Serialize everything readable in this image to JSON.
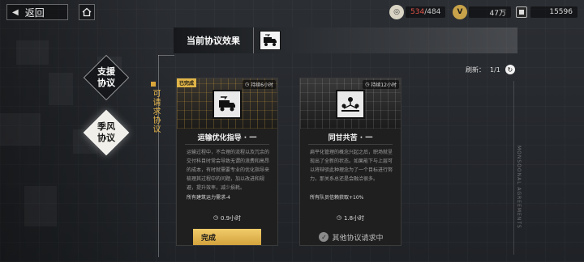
{
  "top_bar": {
    "back_label": "返回",
    "resources": [
      {
        "icon": "gold-coin-icon",
        "current": "534",
        "max": "/484"
      },
      {
        "icon": "v-coin-icon",
        "value": "47万"
      },
      {
        "icon": "chip-icon",
        "value": "15596"
      }
    ]
  },
  "nav": {
    "items": [
      {
        "label": "支援\n协议"
      },
      {
        "label": "季风\n协议"
      }
    ]
  },
  "header": {
    "title": "当前协议效果"
  },
  "panel": {
    "side_label": "可请求协议",
    "refresh_label": "刷新：",
    "refresh_count": "1/1",
    "vertical_text": "MONSOONAL AGREEMENTS"
  },
  "cards": [
    {
      "badge": "已完成",
      "duration": "持续6小时",
      "title": "运输优化指导 · 一",
      "description": "运输过程中，不合理的流程以及冗余的交付科目时常会导致无谓的浪费和高昂的成本，有时就需要专业的优化指导来梳理其过程中的问题，加以改进和规避，提升效率，减少损耗。",
      "effect": "所有建筑运力需求-4",
      "time": "0.9小时",
      "action_label": "完成"
    },
    {
      "duration": "持续12小时",
      "title": "同甘共苦 · 一",
      "description": "扁平化管理的概念兴起之后，职场就呈现出了全新的状态。如果能下与上层可以将辩驳此种理念为了一个目标进行努力，那关系总还是会融洽很多。",
      "effect": "所有队员信赖获取+10%",
      "time": "1.8小时",
      "status_label": "其他协议请求中"
    }
  ],
  "colors": {
    "accent_gold": "#e0b548",
    "background": "#24272c",
    "red_value": "#e0544a"
  }
}
